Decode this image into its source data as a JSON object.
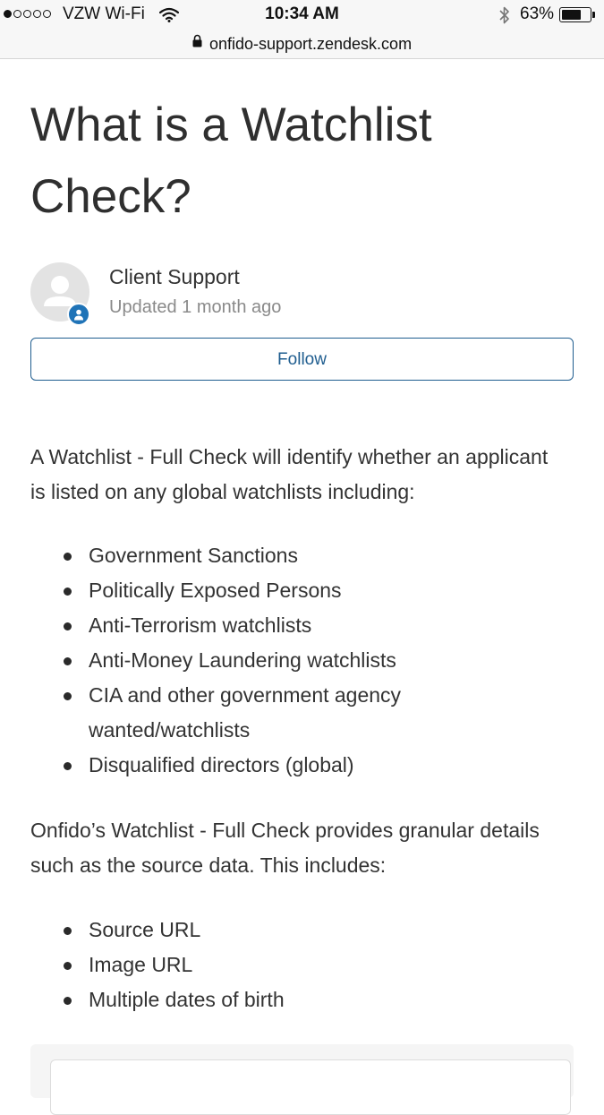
{
  "status_bar": {
    "carrier": "VZW Wi-Fi",
    "signal_bars_filled": 1,
    "signal_bars_total": 5,
    "time": "10:34 AM",
    "battery_percent": "63%"
  },
  "url_bar": {
    "domain": "onfido-support.zendesk.com"
  },
  "article": {
    "title": "What is a Watchlist Check?",
    "author": "Client Support",
    "updated": "Updated 1 month ago",
    "follow_label": "Follow",
    "intro": "A Watchlist - Full Check will identify whether an applicant is listed on any global watchlists including:",
    "watchlists": [
      "Government Sanctions",
      "Politically Exposed Persons",
      "Anti-Terrorism watchlists",
      "Anti-Money Laundering watchlists",
      "CIA and other government agency wanted/watchlists",
      "Disqualified directors (global)"
    ],
    "details_intro": "Onfido’s Watchlist - Full Check provides granular details such as the source data. This includes:",
    "details": [
      "Source URL",
      "Image URL",
      "Multiple dates of birth"
    ]
  },
  "colors": {
    "accent": "#1f5d8f",
    "badge": "#1f73b7",
    "text": "#333333",
    "muted": "#8a8a8a"
  },
  "icons": {
    "status": [
      "signal-dots-icon",
      "wifi-icon",
      "bluetooth-icon",
      "battery-icon"
    ],
    "url": "lock-icon",
    "author": [
      "avatar-placeholder-icon",
      "user-badge-icon"
    ]
  }
}
